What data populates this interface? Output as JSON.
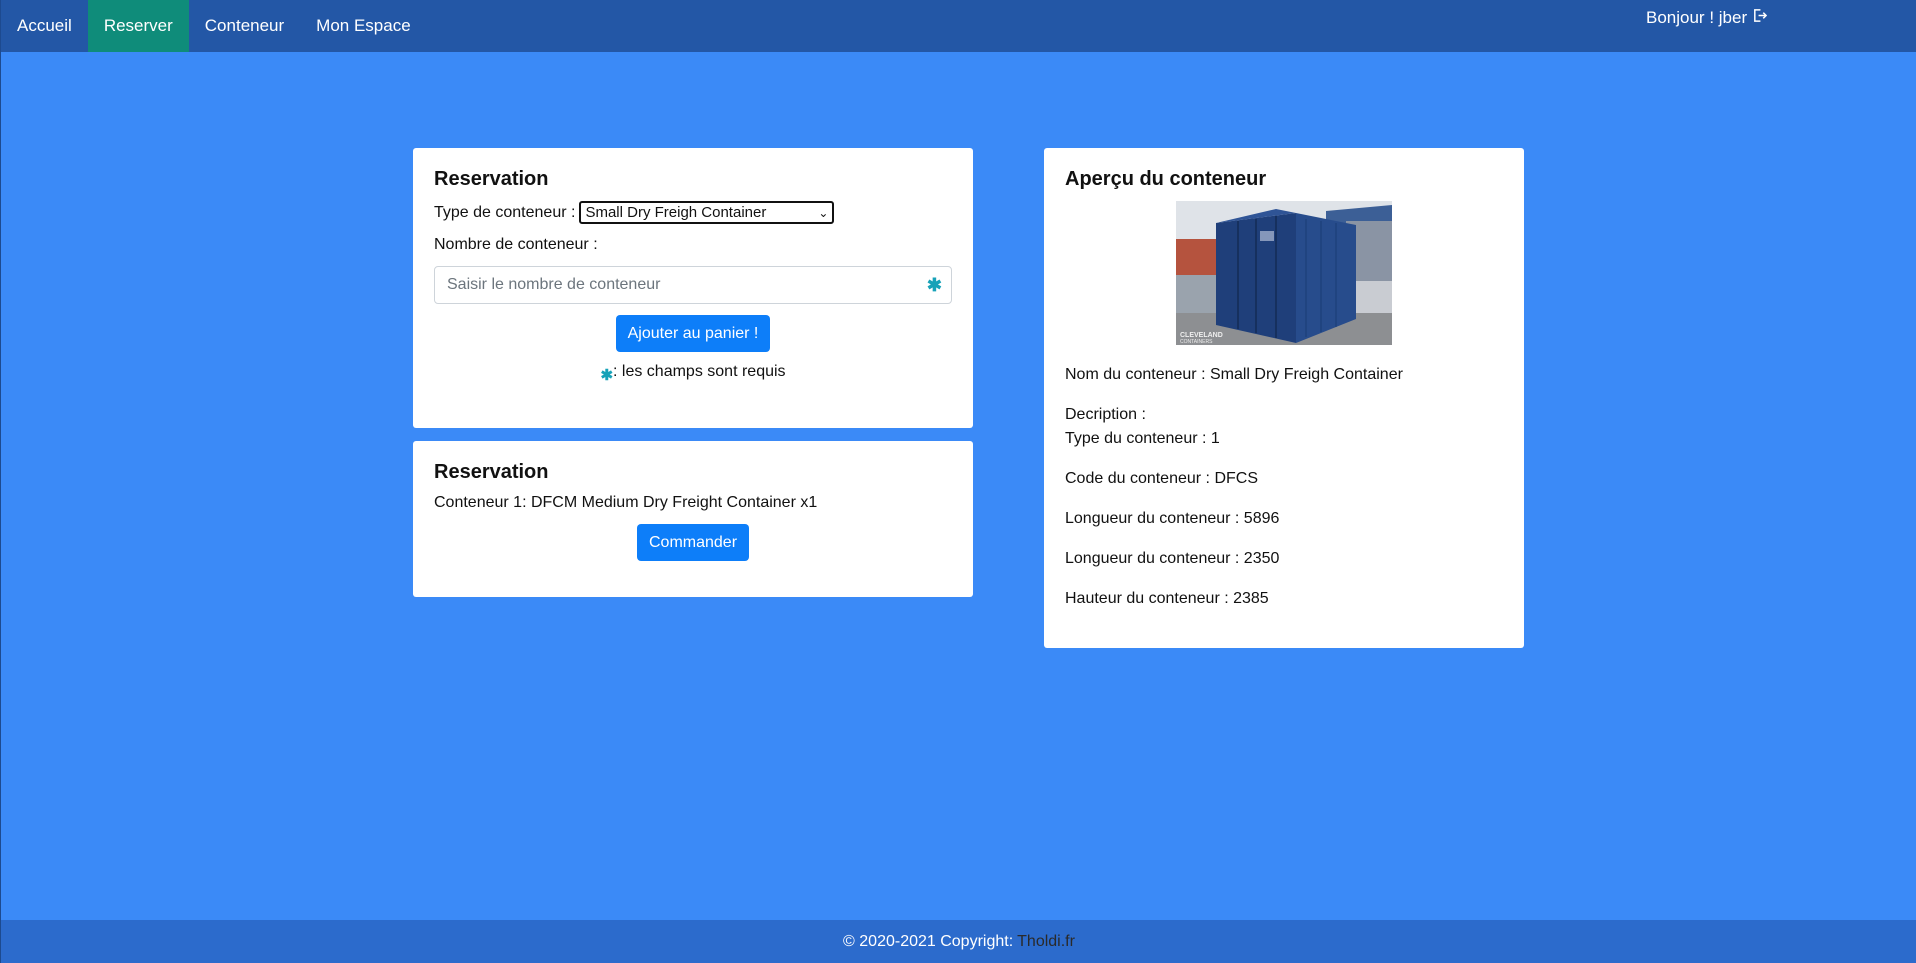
{
  "nav": {
    "items": [
      {
        "label": "Accueil"
      },
      {
        "label": "Reserver"
      },
      {
        "label": "Conteneur"
      },
      {
        "label": "Mon Espace"
      }
    ],
    "active": "Reserver",
    "user_label": "Bonjour ! jber",
    "logout_icon": "logout-icon"
  },
  "reservation_form": {
    "title": "Reservation",
    "type_label": "Type de conteneur :",
    "type_selected": "Small Dry Freigh Container",
    "count_label": "Nombre de conteneur :",
    "count_placeholder": "Saisir le nombre de conteneur",
    "count_value": "",
    "required_star": "✱",
    "add_button": "Ajouter au panier !",
    "required_note": ": les champs sont requis"
  },
  "cart": {
    "title": "Reservation",
    "items": [
      "Conteneur 1: DFCM Medium Dry Freight Container x1"
    ],
    "order_button": "Commander"
  },
  "preview": {
    "title": "Aperçu du conteneur",
    "name_line": "Nom du conteneur : Small Dry Freigh Container",
    "description_line": "Decription :",
    "type_line": "Type du conteneur : 1",
    "code_line": "Code du conteneur : DFCS",
    "length_line": "Longueur du conteneur : 5896",
    "width_line": "Longueur du conteneur : 2350",
    "height_line": "Hauteur du conteneur : 2385",
    "image_watermark": "CLEVELAND CONTAINERS"
  },
  "footer": {
    "copyright": "© 2020-2021 Copyright:",
    "link": "Tholdi.fr"
  },
  "colors": {
    "page_bg": "#3b8af7",
    "navbar_bg": "#2357a6",
    "nav_active_bg": "#0f8c7a",
    "button_bg": "#0d7ef9",
    "required_star": "#17a2b8",
    "footer_bg": "#2c6bcc"
  }
}
